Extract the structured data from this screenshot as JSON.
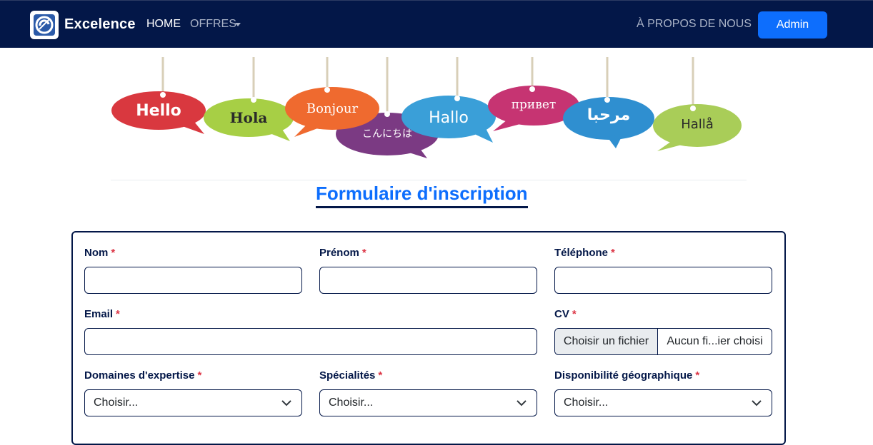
{
  "navbar": {
    "brand_name": "Excelence",
    "home_label": "HOME",
    "offres_label": "OFFRES",
    "about_label": "À PROPOS DE NOUS",
    "admin_label": "Admin",
    "background": "#031748",
    "accent": "#0d6efd"
  },
  "banner": {
    "bubbles": [
      {
        "text": "Hello",
        "color": "#d9383f"
      },
      {
        "text": "Hola",
        "color": "#a7cf45"
      },
      {
        "text": "Bonjour",
        "color": "#ef6a2f"
      },
      {
        "text": "こんにちは",
        "color": "#7b3a83"
      },
      {
        "text": "Hallo",
        "color": "#3a9fd8"
      },
      {
        "text": "привет",
        "color": "#c63472"
      },
      {
        "text": "مرحبا",
        "color": "#2f8fd0"
      },
      {
        "text": "Hallå",
        "color": "#a9cd58"
      }
    ]
  },
  "form": {
    "title": "Formulaire d'inscription",
    "required_marker": "*",
    "nom_label": "Nom",
    "prenom_label": "Prénom",
    "telephone_label": "Téléphone",
    "email_label": "Email",
    "cv_label": "CV",
    "cv_button": "Choisir un fichier",
    "cv_status": "Aucun fi...ier choisi",
    "domaines_label": "Domaines d'expertise",
    "domaines_value": "Choisir...",
    "specialites_label": "Spécialités",
    "specialites_value": "Choisir...",
    "disponibilite_label": "Disponibilité géographique",
    "disponibilite_value": "Choisir..."
  }
}
